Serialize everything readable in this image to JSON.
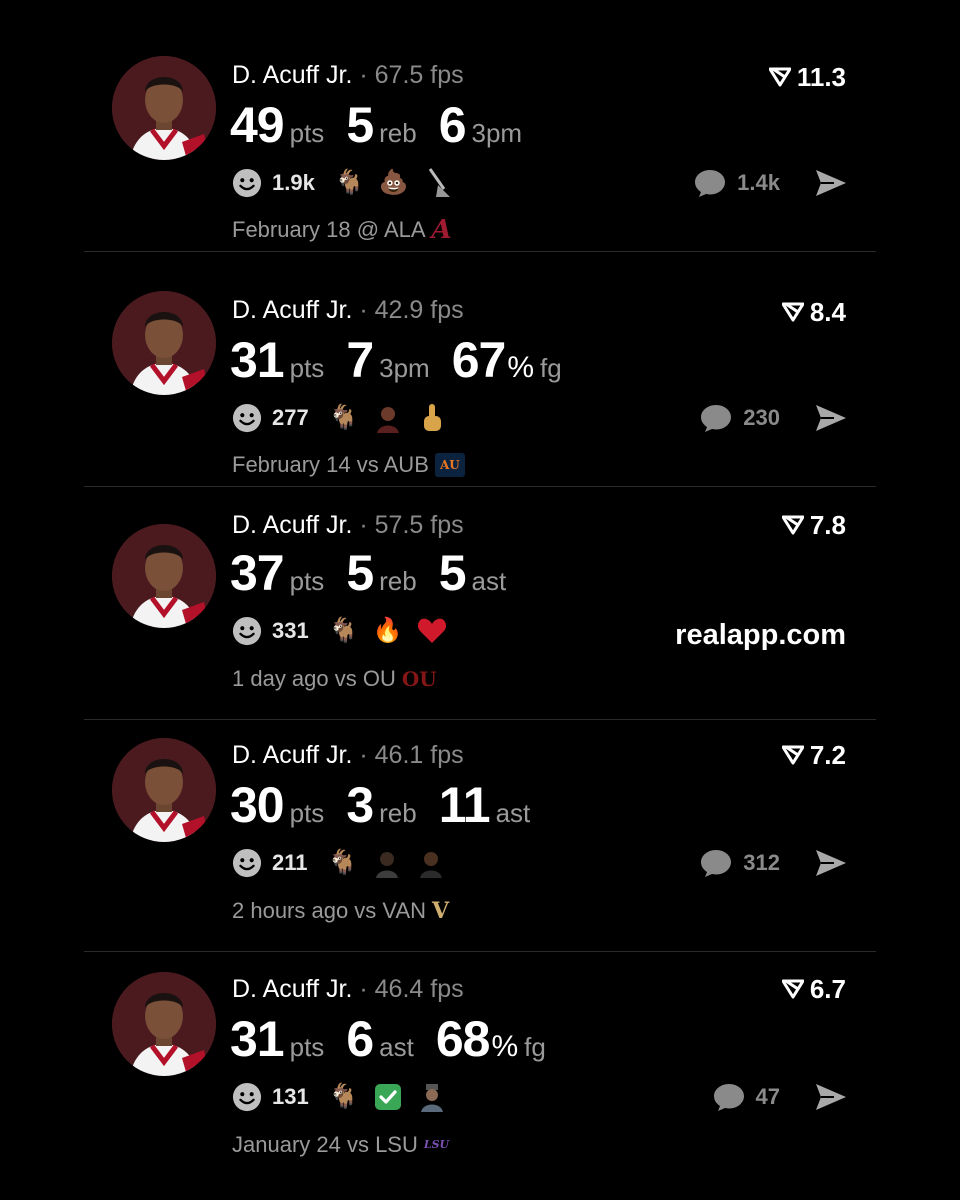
{
  "feed": [
    {
      "player": "D. Acuff Jr.",
      "fps": "67.5 fps",
      "score": "11.3",
      "stats": [
        {
          "num": "49",
          "pct": "",
          "unit": "pts"
        },
        {
          "num": "5",
          "pct": "",
          "unit": "reb"
        },
        {
          "num": "6",
          "pct": "",
          "unit": "3pm"
        }
      ],
      "reactions_count": "1.9k",
      "reaction_emojis": [
        "goat-emoji",
        "poop-emoji",
        "broom-emoji"
      ],
      "comments_count": "1.4k",
      "game": "February 18 @ ALA",
      "team_logo": "A",
      "team_color": "#9e1b32"
    },
    {
      "player": "D. Acuff Jr.",
      "fps": "42.9 fps",
      "score": "8.4",
      "stats": [
        {
          "num": "31",
          "pct": "",
          "unit": "pts"
        },
        {
          "num": "7",
          "pct": "",
          "unit": "3pm"
        },
        {
          "num": "67",
          "pct": "%",
          "unit": "fg"
        }
      ],
      "reactions_count": "277",
      "reaction_emojis": [
        "goat-emoji",
        "player-sticker",
        "middle-finger-emoji"
      ],
      "comments_count": "230",
      "game": "February 14 vs AUB",
      "team_logo": "AU",
      "team_color": "#0c2340"
    },
    {
      "player": "D. Acuff Jr.",
      "fps": "57.5 fps",
      "score": "7.8",
      "stats": [
        {
          "num": "37",
          "pct": "",
          "unit": "pts"
        },
        {
          "num": "5",
          "pct": "",
          "unit": "reb"
        },
        {
          "num": "5",
          "pct": "",
          "unit": "ast"
        }
      ],
      "reactions_count": "331",
      "reaction_emojis": [
        "goat-emoji",
        "fire-emoji",
        "heart-emoji"
      ],
      "watermark": "realapp.com",
      "game": "1 day ago vs OU",
      "team_logo": "OU",
      "team_color": "#841617"
    },
    {
      "player": "D. Acuff Jr.",
      "fps": "46.1 fps",
      "score": "7.2",
      "stats": [
        {
          "num": "30",
          "pct": "",
          "unit": "pts"
        },
        {
          "num": "3",
          "pct": "",
          "unit": "reb"
        },
        {
          "num": "11",
          "pct": "",
          "unit": "ast"
        }
      ],
      "reactions_count": "211",
      "reaction_emojis": [
        "goat-emoji",
        "person-sticker",
        "person-sticker"
      ],
      "comments_count": "312",
      "game": "2 hours ago vs VAN",
      "team_logo": "V",
      "team_color": "#cfae70"
    },
    {
      "player": "D. Acuff Jr.",
      "fps": "46.4 fps",
      "score": "6.7",
      "stats": [
        {
          "num": "31",
          "pct": "",
          "unit": "pts"
        },
        {
          "num": "6",
          "pct": "",
          "unit": "ast"
        },
        {
          "num": "68",
          "pct": "%",
          "unit": "fg"
        }
      ],
      "reactions_count": "131",
      "reaction_emojis": [
        "goat-emoji",
        "check-mark-emoji",
        "person-sticker"
      ],
      "comments_count": "47",
      "game": "January 24 vs LSU",
      "team_logo": "LSU",
      "team_color": "#7b4fb0"
    }
  ]
}
